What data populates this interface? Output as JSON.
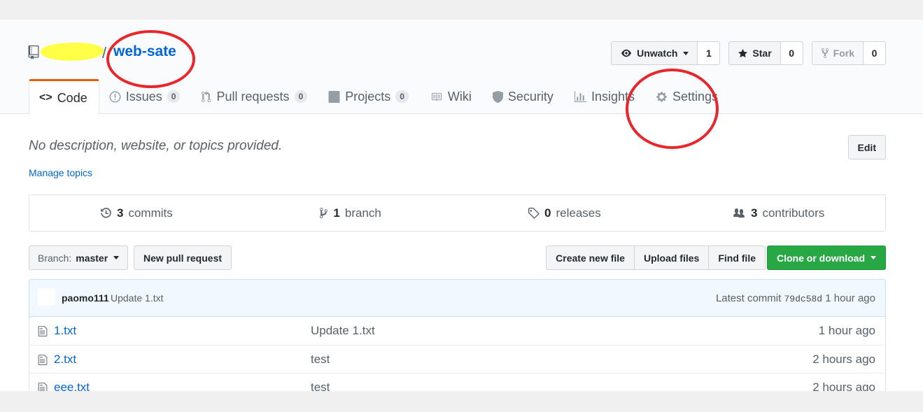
{
  "repo": {
    "owner": "",
    "name": "web-sate"
  },
  "actions": {
    "watch": {
      "label": "Unwatch",
      "count": "1"
    },
    "star": {
      "label": "Star",
      "count": "0"
    },
    "fork": {
      "label": "Fork",
      "count": "0"
    }
  },
  "tabs": [
    {
      "label": "Code",
      "icon": "code-icon"
    },
    {
      "label": "Issues",
      "icon": "issue-icon",
      "count": "0"
    },
    {
      "label": "Pull requests",
      "icon": "git-pull-request-icon",
      "count": "0"
    },
    {
      "label": "Projects",
      "icon": "project-icon",
      "count": "0"
    },
    {
      "label": "Wiki",
      "icon": "book-icon"
    },
    {
      "label": "Security",
      "icon": "shield-icon"
    },
    {
      "label": "Insights",
      "icon": "graph-icon"
    },
    {
      "label": "Settings",
      "icon": "gear-icon"
    }
  ],
  "about": {
    "description": "No description, website, or topics provided.",
    "manage_topics": "Manage topics",
    "edit": "Edit"
  },
  "summary": [
    {
      "count": "3",
      "label": "commits",
      "icon": "history-icon"
    },
    {
      "count": "1",
      "label": "branch",
      "icon": "git-branch-icon"
    },
    {
      "count": "0",
      "label": "releases",
      "icon": "tag-icon"
    },
    {
      "count": "3",
      "label": "contributors",
      "icon": "people-icon"
    }
  ],
  "file_nav": {
    "branch_prefix": "Branch:",
    "branch": "master",
    "new_pull_request": "New pull request",
    "create_new_file": "Create new file",
    "upload_files": "Upload files",
    "find_file": "Find file",
    "clone_or_download": "Clone or download"
  },
  "latest_commit": {
    "author": "paomo111",
    "message": "Update 1.txt",
    "prefix": "Latest commit",
    "sha": "79dc58d",
    "age": "1 hour ago"
  },
  "files": [
    {
      "name": "1.txt",
      "message": "Update 1.txt",
      "age": "1 hour ago"
    },
    {
      "name": "2.txt",
      "message": "test",
      "age": "2 hours ago"
    },
    {
      "name": "eee.txt",
      "message": "test",
      "age": "2 hours ago"
    }
  ],
  "colors": {
    "link": "#0366d6",
    "accent_tab": "#e36209",
    "clone_button": "#28a745",
    "annotation": "#e8262c",
    "owner_highlight": "#ffff33"
  }
}
